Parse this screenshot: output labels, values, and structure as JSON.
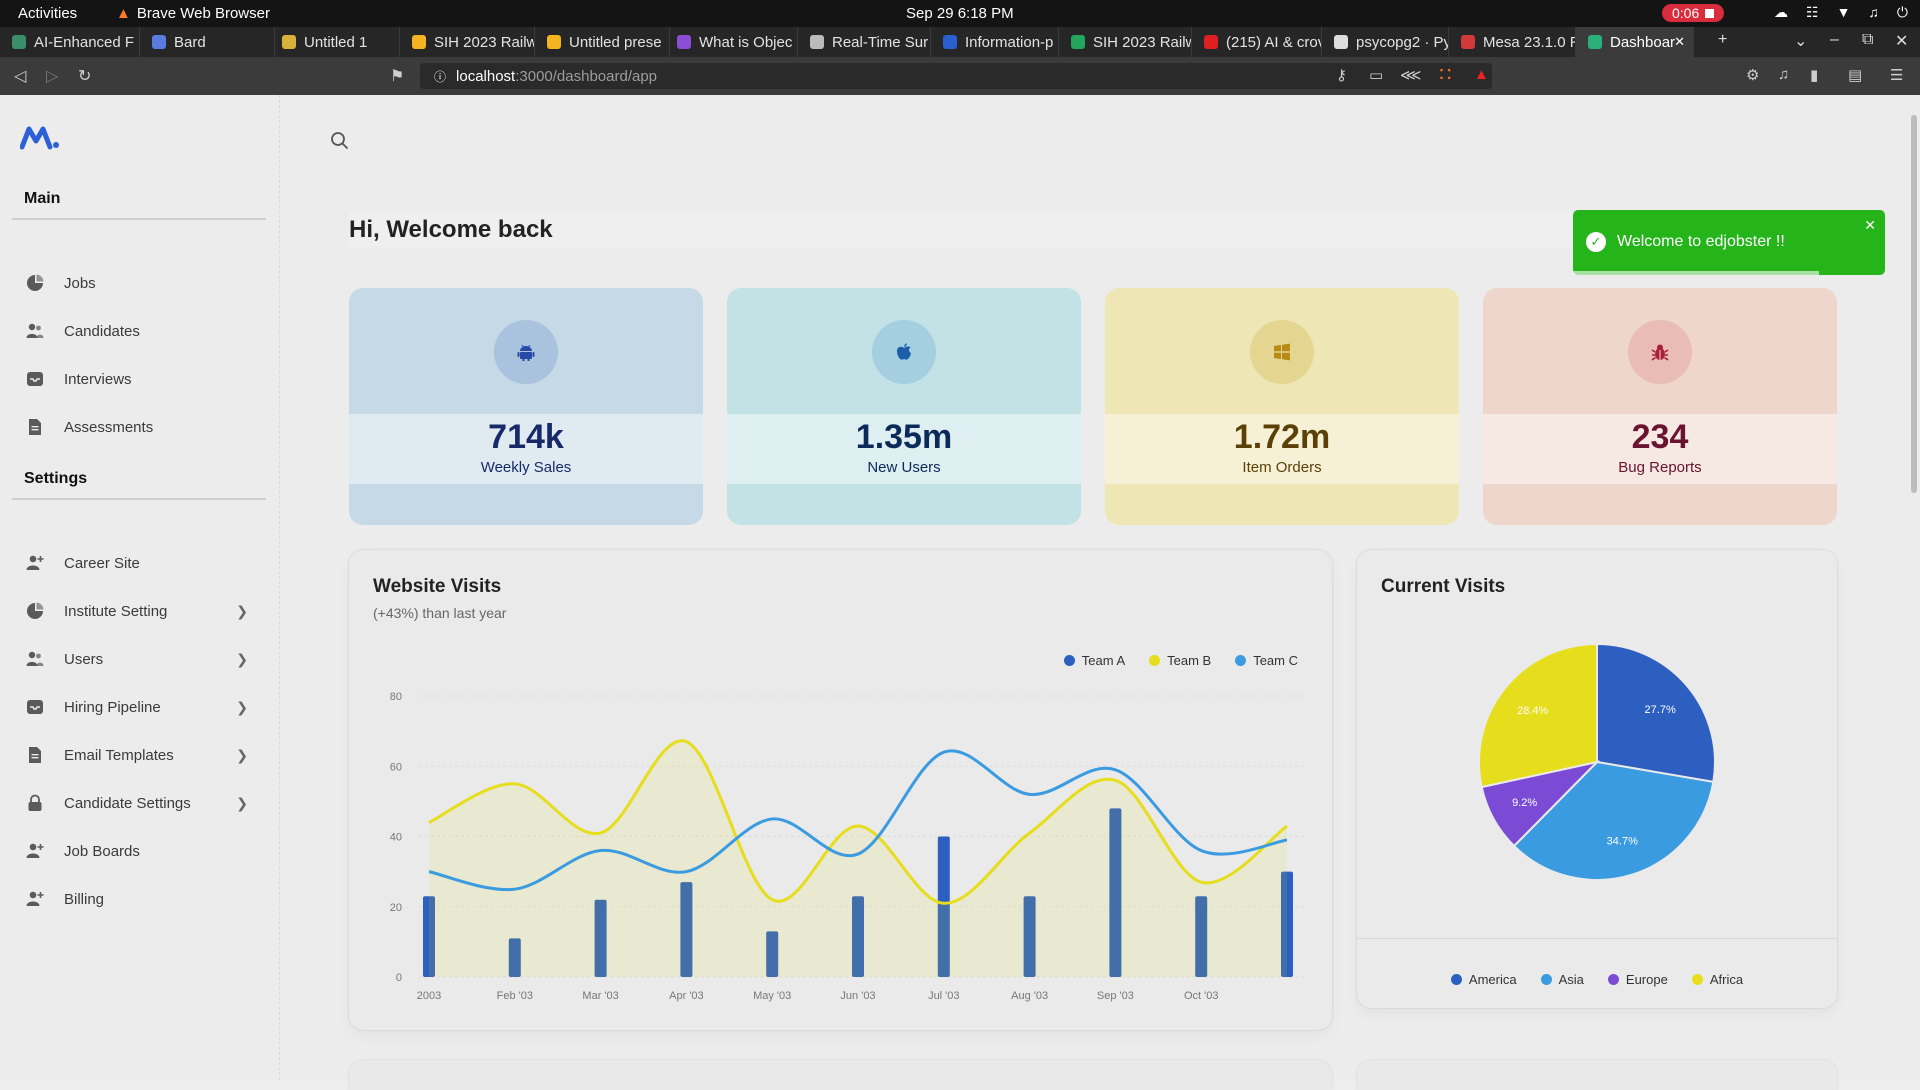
{
  "system": {
    "activities": "Activities",
    "app_name": "Brave Web Browser",
    "clock": "Sep 29  6:18 PM",
    "recording": "0:06"
  },
  "browser": {
    "tabs": [
      {
        "label": "AI-Enhanced F",
        "color": "#3a8f6a"
      },
      {
        "label": "Bard",
        "color": "#5a7be0"
      },
      {
        "label": "Untitled 1",
        "color": "#d8b23a"
      },
      {
        "label": "SIH 2023 Railw",
        "color": "#f2b51f"
      },
      {
        "label": "Untitled prese",
        "color": "#f2b51f"
      },
      {
        "label": "What is Objec",
        "color": "#8a4ed6"
      },
      {
        "label": "Real-Time Sur",
        "color": "#bbbbbb"
      },
      {
        "label": "Information-p",
        "color": "#2a5fd0"
      },
      {
        "label": "SIH 2023 Railw",
        "color": "#22a55c"
      },
      {
        "label": "(215) AI & crov",
        "color": "#e02020"
      },
      {
        "label": "psycopg2 · Py",
        "color": "#dddddd"
      },
      {
        "label": "Mesa 23.1.0 R",
        "color": "#d23a3a"
      },
      {
        "label": "Dashboar",
        "color": "#2bb07a",
        "active": true
      }
    ],
    "url_host": "localhost",
    "url_path": ":3000/dashboard/app"
  },
  "sidebar": {
    "main_label": "Main",
    "main_items": [
      {
        "label": "Jobs",
        "icon": "pie-icon"
      },
      {
        "label": "Candidates",
        "icon": "users-icon"
      },
      {
        "label": "Interviews",
        "icon": "inbox-icon"
      },
      {
        "label": "Assessments",
        "icon": "document-icon"
      }
    ],
    "settings_label": "Settings",
    "settings_items": [
      {
        "label": "Career Site",
        "icon": "user-plus-icon",
        "chevron": false
      },
      {
        "label": "Institute Setting",
        "icon": "pie-icon",
        "chevron": true
      },
      {
        "label": "Users",
        "icon": "users-icon",
        "chevron": true
      },
      {
        "label": "Hiring Pipeline",
        "icon": "inbox-icon",
        "chevron": true
      },
      {
        "label": "Email Templates",
        "icon": "document-icon",
        "chevron": true
      },
      {
        "label": "Candidate Settings",
        "icon": "lock-icon",
        "chevron": true
      },
      {
        "label": "Job Boards",
        "icon": "user-plus-icon",
        "chevron": false
      },
      {
        "label": "Billing",
        "icon": "user-plus-icon",
        "chevron": false
      }
    ]
  },
  "main": {
    "greeting": "Hi, Welcome back"
  },
  "stats": [
    {
      "value": "714k",
      "label": "Weekly Sales",
      "icon": "android-icon",
      "bg": "#c5d9e6",
      "circle": "#a9c2de",
      "fg": "#18296a",
      "icon_color": "#2749a6"
    },
    {
      "value": "1.35m",
      "label": "New Users",
      "icon": "apple-icon",
      "bg": "#c3e2e5",
      "circle": "#a4cfe0",
      "fg": "#0b2a5a",
      "icon_color": "#1c5fa8"
    },
    {
      "value": "1.72m",
      "label": "Item Orders",
      "icon": "windows-icon",
      "bg": "#eee6b5",
      "circle": "#e4d591",
      "fg": "#5a3f06",
      "icon_color": "#b98a14"
    },
    {
      "value": "234",
      "label": "Bug Reports",
      "icon": "bug-icon",
      "bg": "#efd6cc",
      "circle": "#e9bcb6",
      "fg": "#6a1330",
      "icon_color": "#a8203a"
    }
  ],
  "toast": {
    "message": "Welcome to edjobster !!",
    "progress": 0.79
  },
  "visits_title": "Website Visits",
  "visits_subtitle": "(+43%) than last year",
  "current_title": "Current Visits",
  "chart_data": [
    {
      "type": "line",
      "title": "Website Visits",
      "subtitle": "(+43%) than last year",
      "categories": [
        "2003",
        "Feb '03",
        "Mar '03",
        "Apr '03",
        "May '03",
        "Jun '03",
        "Jul '03",
        "Aug '03",
        "Sep '03",
        "Oct '03",
        ""
      ],
      "ylim": [
        0,
        80
      ],
      "yticks": [
        0,
        20,
        40,
        60,
        80
      ],
      "grid": true,
      "legend": "top-right",
      "series": [
        {
          "name": "Team A",
          "kind": "bar",
          "color": "#2c5fbf",
          "values": [
            23,
            11,
            22,
            27,
            13,
            23,
            40,
            23,
            48,
            23,
            30
          ]
        },
        {
          "name": "Team B",
          "kind": "area",
          "color": "#e6dd1c",
          "values": [
            44,
            55,
            41,
            67,
            22,
            43,
            21,
            41,
            56,
            27,
            43
          ]
        },
        {
          "name": "Team C",
          "kind": "line",
          "color": "#3a9be0",
          "values": [
            30,
            25,
            36,
            30,
            45,
            35,
            64,
            52,
            59,
            36,
            39
          ]
        }
      ]
    },
    {
      "type": "pie",
      "title": "Current Visits",
      "legend": "bottom",
      "slices": [
        {
          "name": "America",
          "value": 27.7,
          "label": "27.7%",
          "color": "#2c5fbf"
        },
        {
          "name": "Asia",
          "value": 34.7,
          "label": "34.7%",
          "color": "#3a9be0"
        },
        {
          "name": "Europe",
          "value": 9.2,
          "label": "9.2%",
          "color": "#7b4bd6"
        },
        {
          "name": "Africa",
          "value": 28.4,
          "label": "28.4%",
          "color": "#e6dd1c"
        }
      ]
    }
  ]
}
